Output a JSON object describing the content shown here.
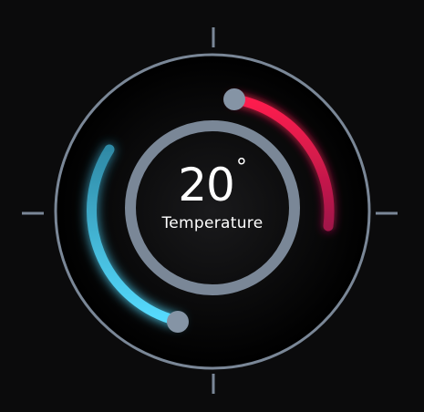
{
  "thermostat": {
    "value": "20",
    "unit": "°",
    "label": "Temperature"
  },
  "colors": {
    "background": "#0b0b0c",
    "dial_face": "#000000",
    "ring": "#7a8797",
    "cold_arc": "#4fd6ff",
    "hot_arc": "#ff1e4e",
    "text": "#ffffff"
  },
  "icons": {
    "cold_knob": "circle-handle",
    "hot_knob": "circle-handle"
  }
}
